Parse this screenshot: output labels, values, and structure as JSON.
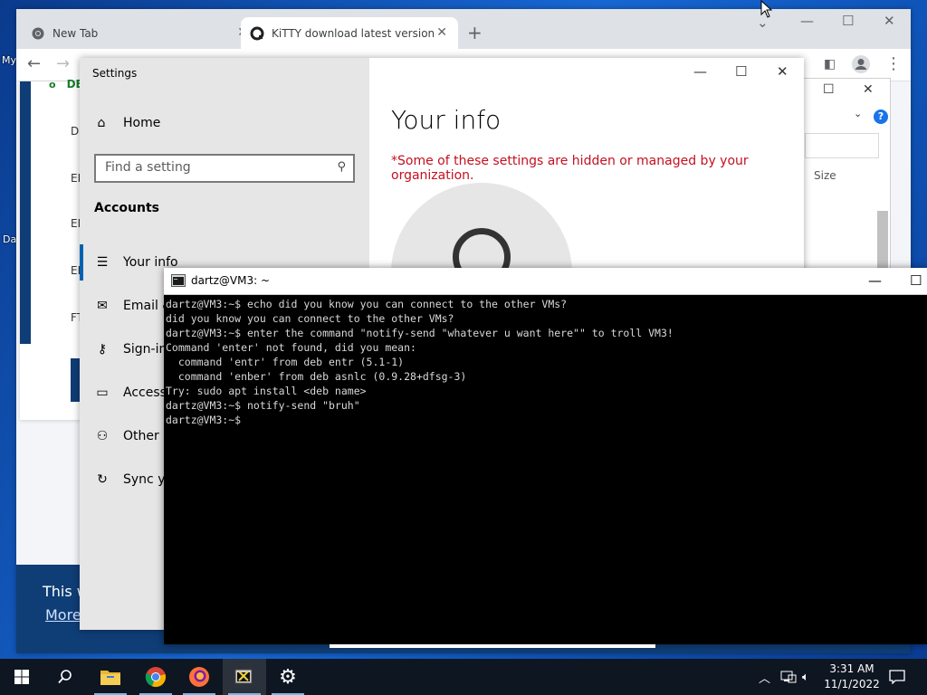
{
  "desktop": {
    "fragments": [
      "My",
      "Da"
    ]
  },
  "chrome": {
    "tabs": [
      {
        "title": "New Tab",
        "icon": "chrome-icon"
      },
      {
        "title": "KiTTY download latest version",
        "icon": "kitty-favicon-icon"
      }
    ],
    "page": {
      "rows": [
        "DE",
        "DI",
        "EE",
        "EN",
        "EN",
        "FT"
      ],
      "banner_line1": "This w",
      "banner_line2": "More"
    }
  },
  "settings": {
    "title": "Settings",
    "home_label": "Home",
    "search_placeholder": "Find a setting",
    "section_header": "Accounts",
    "nav": [
      {
        "label": "Your info",
        "icon": "user-card-icon"
      },
      {
        "label": "Email &",
        "icon": "mail-icon"
      },
      {
        "label": "Sign-in",
        "icon": "key-icon"
      },
      {
        "label": "Access",
        "icon": "briefcase-icon"
      },
      {
        "label": "Other u",
        "icon": "add-user-icon"
      },
      {
        "label": "Sync yo",
        "icon": "sync-icon"
      }
    ],
    "heading": "Your info",
    "warning": "*Some of these settings are hidden or managed by your organization."
  },
  "explorer": {
    "size_header": "Size",
    "help": "?"
  },
  "terminal": {
    "title": "dartz@VM3: ~",
    "lines": [
      "dartz@VM3:~$ echo did you know you can connect to the other VMs?",
      "did you know you can connect to the other VMs?",
      "dartz@VM3:~$ enter the command \"notify-send \"whatever u want here\"\" to troll VM3!",
      "Command 'enter' not found, did you mean:",
      "  command 'entr' from deb entr (5.1-1)",
      "  command 'enber' from deb asnlc (0.9.28+dfsg-3)",
      "Try: sudo apt install <deb name>",
      "dartz@VM3:~$ notify-send \"bruh\"",
      "dartz@VM3:~$ "
    ]
  },
  "taskbar": {
    "time": "3:31 AM",
    "date": "11/1/2022"
  },
  "colors": {
    "accent": "#0063b1",
    "warning": "#c50f1f",
    "taskbar": "#0e1621"
  }
}
